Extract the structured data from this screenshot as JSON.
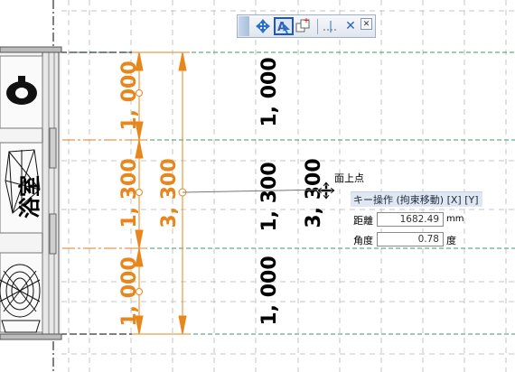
{
  "toolbar": {
    "buttons": [
      {
        "name": "move-icon",
        "active": false
      },
      {
        "name": "text-select-icon",
        "active": true
      },
      {
        "name": "copy-icon",
        "active": false
      },
      {
        "name": "snap-point-icon",
        "active": false
      },
      {
        "name": "cancel-icon",
        "active": false
      },
      {
        "name": "close-icon",
        "active": false
      }
    ]
  },
  "dimensions": {
    "orange_segments": [
      "1, 000",
      "1, 300",
      "1, 000"
    ],
    "orange_total": "3, 300",
    "black_segments": [
      "1, 000",
      "1, 300",
      "1, 000"
    ],
    "black_total": "3, 300"
  },
  "room_label": "浴室",
  "cursor_info": {
    "snap_label": "面上点",
    "key_hint": "キー操作 (拘束移動) [X] [Y]",
    "distance_label": "距離",
    "distance_value": "1682.49",
    "distance_unit": "mm",
    "angle_label": "角度",
    "angle_value": "0.78",
    "angle_unit": "度"
  },
  "colors": {
    "dimension_orange": "#e8861c",
    "guide_green": "#3a9a66",
    "guide_orange": "#e07b28",
    "grid_gray": "#bdbdbd",
    "selected_button_border": "#1f54c9"
  }
}
